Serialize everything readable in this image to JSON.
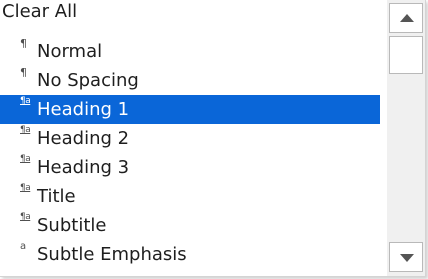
{
  "style_list": {
    "items": [
      {
        "label": "Clear All",
        "mark": "",
        "mark_type": "none",
        "selected": false
      },
      {
        "label": "Normal",
        "mark": "¶",
        "mark_type": "para",
        "selected": false
      },
      {
        "label": "No Spacing",
        "mark": "¶",
        "mark_type": "para",
        "selected": false
      },
      {
        "label": "Heading 1",
        "mark": "¶a",
        "mark_type": "link",
        "selected": true
      },
      {
        "label": "Heading 2",
        "mark": "¶a",
        "mark_type": "link",
        "selected": false
      },
      {
        "label": "Heading 3",
        "mark": "¶a",
        "mark_type": "link",
        "selected": false
      },
      {
        "label": "Title",
        "mark": "¶a",
        "mark_type": "link",
        "selected": false
      },
      {
        "label": "Subtitle",
        "mark": "¶a",
        "mark_type": "link",
        "selected": false
      },
      {
        "label": "Subtle Emphasis",
        "mark": "a",
        "mark_type": "char",
        "selected": false
      }
    ],
    "selected_color": "#0a66d8"
  },
  "scrollbar": {
    "up_icon": "triangle-up-icon",
    "down_icon": "triangle-down-icon"
  }
}
